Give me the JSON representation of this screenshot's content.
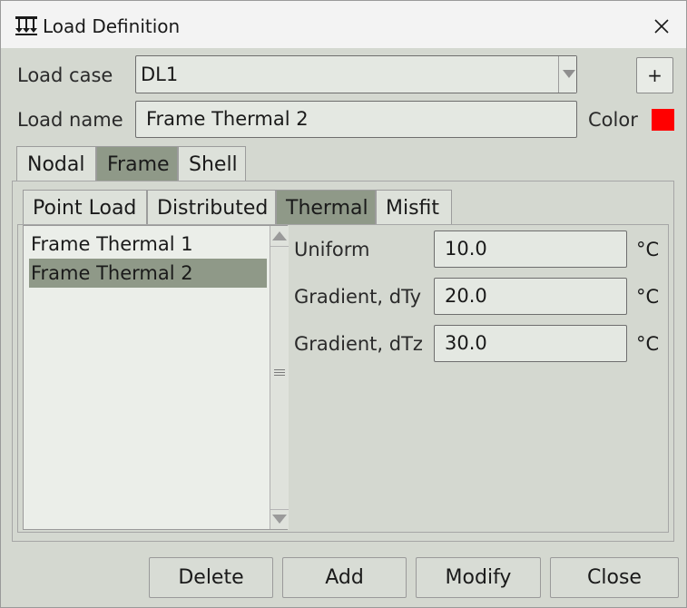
{
  "window": {
    "title": "Load Definition",
    "icon": "load-definition-icon",
    "close_icon": "close-icon"
  },
  "load_case": {
    "label": "Load case",
    "value": "DL1",
    "add_label": "+"
  },
  "load_name": {
    "label": "Load name",
    "value": "Frame Thermal 2"
  },
  "color": {
    "label": "Color",
    "value": "#ff0000"
  },
  "tabs": [
    {
      "label": "Nodal",
      "active": false
    },
    {
      "label": "Frame",
      "active": true
    },
    {
      "label": "Shell",
      "active": false
    }
  ],
  "subtabs": [
    {
      "label": "Point Load",
      "active": false
    },
    {
      "label": "Distributed",
      "active": false
    },
    {
      "label": "Thermal",
      "active": true
    },
    {
      "label": "Misfit",
      "active": false
    }
  ],
  "loads_list": [
    {
      "label": "Frame Thermal 1",
      "selected": false
    },
    {
      "label": "Frame Thermal 2",
      "selected": true
    }
  ],
  "thermal": {
    "uniform": {
      "label": "Uniform",
      "value": "10.0",
      "unit": "°C"
    },
    "gradient_dty": {
      "label": "Gradient, dTy",
      "value": "20.0",
      "unit": "°C"
    },
    "gradient_dtz": {
      "label": "Gradient, dTz",
      "value": "30.0",
      "unit": "°C"
    }
  },
  "buttons": {
    "delete": "Delete",
    "add": "Add",
    "modify": "Modify",
    "close": "Close"
  },
  "colors": {
    "active_tab": "#8f9988",
    "dialog_bg": "#d4d8d0",
    "field_bg": "#e4e8e2"
  }
}
